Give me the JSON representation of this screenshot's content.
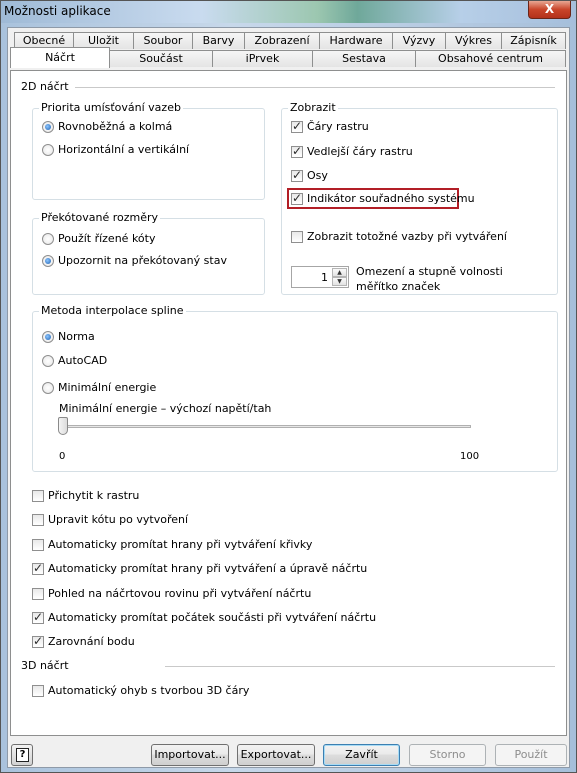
{
  "window": {
    "title": "Možnosti aplikace",
    "close_label": "X"
  },
  "tabs": {
    "row1": [
      "Obecné",
      "Uložit",
      "Soubor",
      "Barvy",
      "Zobrazení",
      "Hardware",
      "Výzvy",
      "Výkres",
      "Zápisník"
    ],
    "row2": [
      "Náčrt",
      "Součást",
      "iPrvek",
      "Sestava",
      "Obsahové centrum"
    ],
    "active": "Náčrt"
  },
  "sketch2d": {
    "title": "2D náčrt",
    "constraint_priority": {
      "label": "Priorita umísťování vazeb",
      "options": [
        {
          "label": "Rovnoběžná a kolmá",
          "selected": true
        },
        {
          "label": "Horizontální a vertikální",
          "selected": false
        }
      ]
    },
    "overconstrained": {
      "label": "Překótované rozměry",
      "options": [
        {
          "label": "Použít řízené kóty",
          "selected": false
        },
        {
          "label": "Upozornit na překótovaný stav",
          "selected": true
        }
      ]
    },
    "display": {
      "label": "Zobrazit",
      "options": [
        {
          "label": "Čáry rastru",
          "checked": true
        },
        {
          "label": "Vedlejší čáry rastru",
          "checked": true
        },
        {
          "label": "Osy",
          "checked": true
        },
        {
          "label": "Indikátor souřadného systému",
          "checked": true
        },
        {
          "label": "Zobrazit totožné vazby při vytváření",
          "checked": false
        }
      ],
      "spinner": {
        "value": "1",
        "label_line1": "Omezení a stupně volnosti",
        "label_line2": "měřítko značek"
      }
    },
    "spline": {
      "label": "Metoda interpolace spline",
      "options": [
        {
          "label": "Norma",
          "selected": true
        },
        {
          "label": "AutoCAD",
          "selected": false
        },
        {
          "label": "Minimální energie",
          "selected": false
        }
      ],
      "slider_label": "Minimální energie – výchozí napětí/tah",
      "slider_min": "0",
      "slider_max": "100",
      "slider_value": 0
    },
    "checkboxes": [
      {
        "label": "Přichytit k rastru",
        "checked": false
      },
      {
        "label": "Upravit kótu po vytvoření",
        "checked": false
      },
      {
        "label": "Automaticky promítat hrany při vytváření křivky",
        "checked": false
      },
      {
        "label": "Automaticky promítat hrany při vytváření a úpravě náčrtu",
        "checked": true
      },
      {
        "label": "Pohled na náčrtovou rovinu při vytváření náčrtu",
        "checked": false
      },
      {
        "label": "Automaticky promítat počátek součásti při vytváření náčrtu",
        "checked": true
      },
      {
        "label": "Zarovnání bodu",
        "checked": true
      }
    ]
  },
  "sketch3d": {
    "title": "3D náčrt",
    "checkboxes": [
      {
        "label": "Automatický ohyb s tvorbou 3D čáry",
        "checked": false
      }
    ]
  },
  "footer": {
    "help_label": "?",
    "import_label": "Importovat...",
    "export_label": "Exportovat...",
    "close_label": "Zavřít",
    "cancel_label": "Storno",
    "apply_label": "Použít"
  }
}
